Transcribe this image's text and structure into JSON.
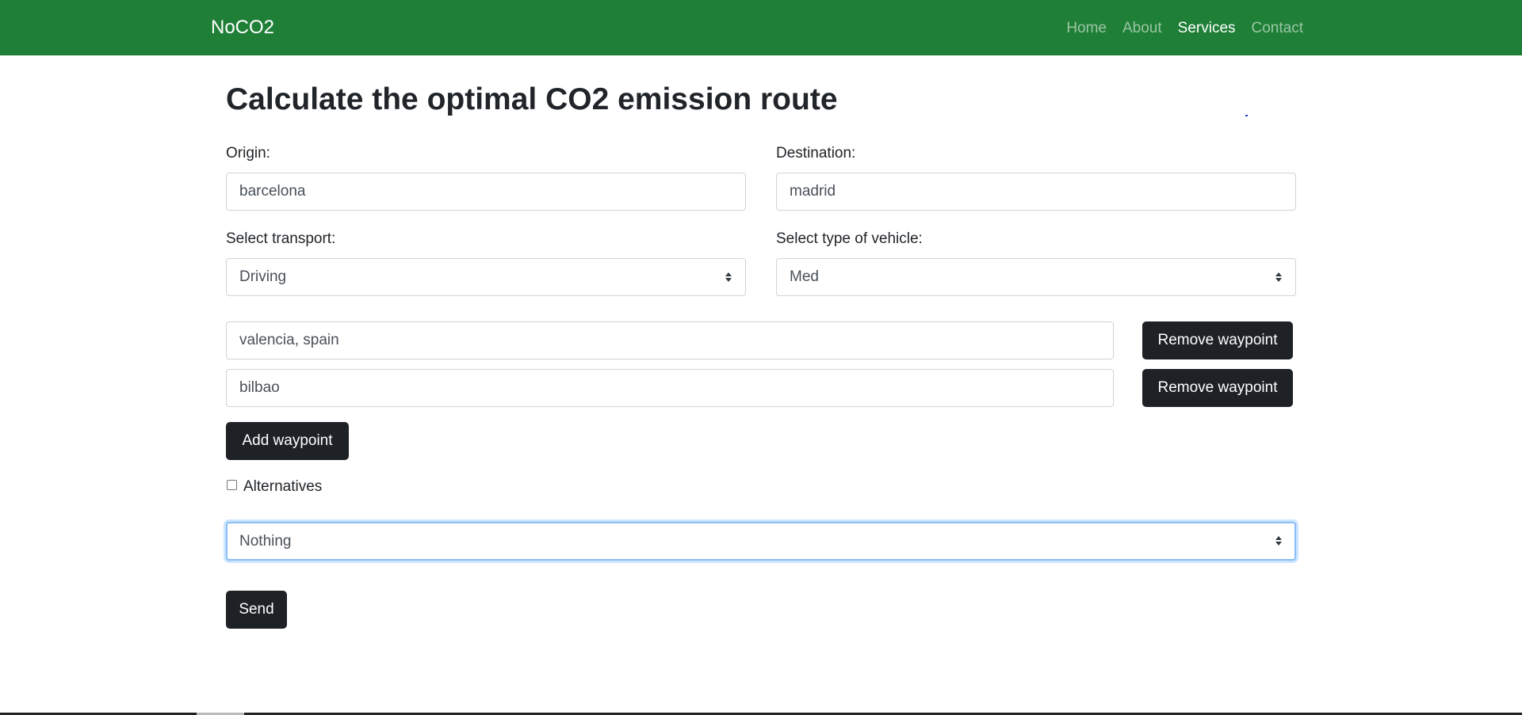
{
  "navbar": {
    "brand": "NoCO2",
    "links": [
      {
        "label": "Home",
        "active": false
      },
      {
        "label": "About",
        "active": false
      },
      {
        "label": "Services",
        "active": true
      },
      {
        "label": "Contact",
        "active": false
      }
    ],
    "background": "#1f7f37"
  },
  "page": {
    "title": "Calculate the optimal CO2 emission route"
  },
  "form": {
    "origin": {
      "label": "Origin:",
      "value": "barcelona"
    },
    "destination": {
      "label": "Destination:",
      "value": "madrid"
    },
    "transport": {
      "label": "Select transport:",
      "value": "Driving"
    },
    "vehicle": {
      "label": "Select type of vehicle:",
      "value": "Med"
    },
    "waypoints": [
      {
        "value": "valencia, spain",
        "remove_label": "Remove waypoint"
      },
      {
        "value": "bilbao",
        "remove_label": "Remove waypoint"
      }
    ],
    "add_waypoint_label": "Add waypoint",
    "alternatives": {
      "label": "Alternatives",
      "checked": false
    },
    "option_select": {
      "value": "Nothing"
    },
    "send_label": "Send"
  },
  "icons": {
    "select_arrows": "sort-arrows-icon"
  }
}
